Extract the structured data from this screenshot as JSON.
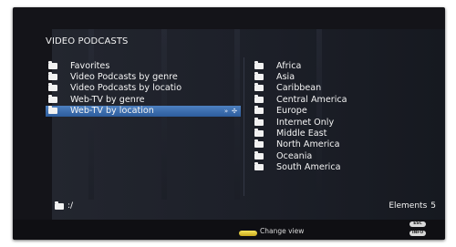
{
  "title": "VIDEO PODCASTS",
  "left_list": [
    {
      "label": "Favorites"
    },
    {
      "label": "Video Podcasts by genre"
    },
    {
      "label": "Video Podcasts by locatio"
    },
    {
      "label": "Web-TV by genre"
    },
    {
      "label": "Web-TV by location",
      "selected": true
    }
  ],
  "right_list": [
    {
      "label": "Africa"
    },
    {
      "label": "Asia"
    },
    {
      "label": "Caribbean"
    },
    {
      "label": "Central America"
    },
    {
      "label": "Europe"
    },
    {
      "label": "Internet Only"
    },
    {
      "label": "Middle East"
    },
    {
      "label": "North America"
    },
    {
      "label": "Oceania"
    },
    {
      "label": "South America"
    }
  ],
  "path": ":/",
  "elements_label": "Elements",
  "elements_count": "5",
  "footer": {
    "change_view": "Change view",
    "btn_top": "ESC",
    "btn_bottom": "INFO"
  },
  "colors": {
    "selection": "#3f70b0",
    "yellow_button": "#e8d040"
  }
}
